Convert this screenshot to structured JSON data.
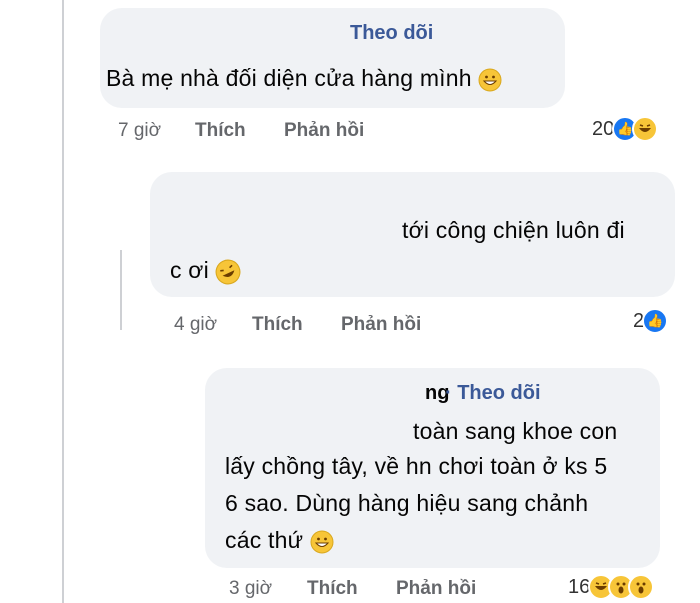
{
  "comments": [
    {
      "follow": "Theo dõi",
      "lines": [
        "Bà mẹ nhà đối diện cửa hàng mình"
      ],
      "time": "7 giờ",
      "like": "Thích",
      "reply": "Phản hồi",
      "reaction_count": "20",
      "reactions": [
        "like-icon",
        "haha-icon"
      ]
    },
    {
      "lines": [
        "tới công chiện luôn đi",
        "c ơi"
      ],
      "time": "4 giờ",
      "like": "Thích",
      "reply": "Phản hồi",
      "reaction_count": "2",
      "reactions": [
        "like-icon"
      ]
    },
    {
      "name_fragment": "ng",
      "follow": "· Theo dõi",
      "lines": [
        "toàn sang khoe con",
        "lấy chồng tây, về hn chơi toàn ở ks 5",
        "6 sao. Dùng hàng hiệu sang chảnh",
        "các thứ"
      ],
      "time": "3 giờ",
      "like": "Thích",
      "reply": "Phản hồi",
      "reaction_count": "16",
      "reactions": [
        "haha-icon",
        "wow-icon",
        "wow-icon"
      ]
    }
  ]
}
